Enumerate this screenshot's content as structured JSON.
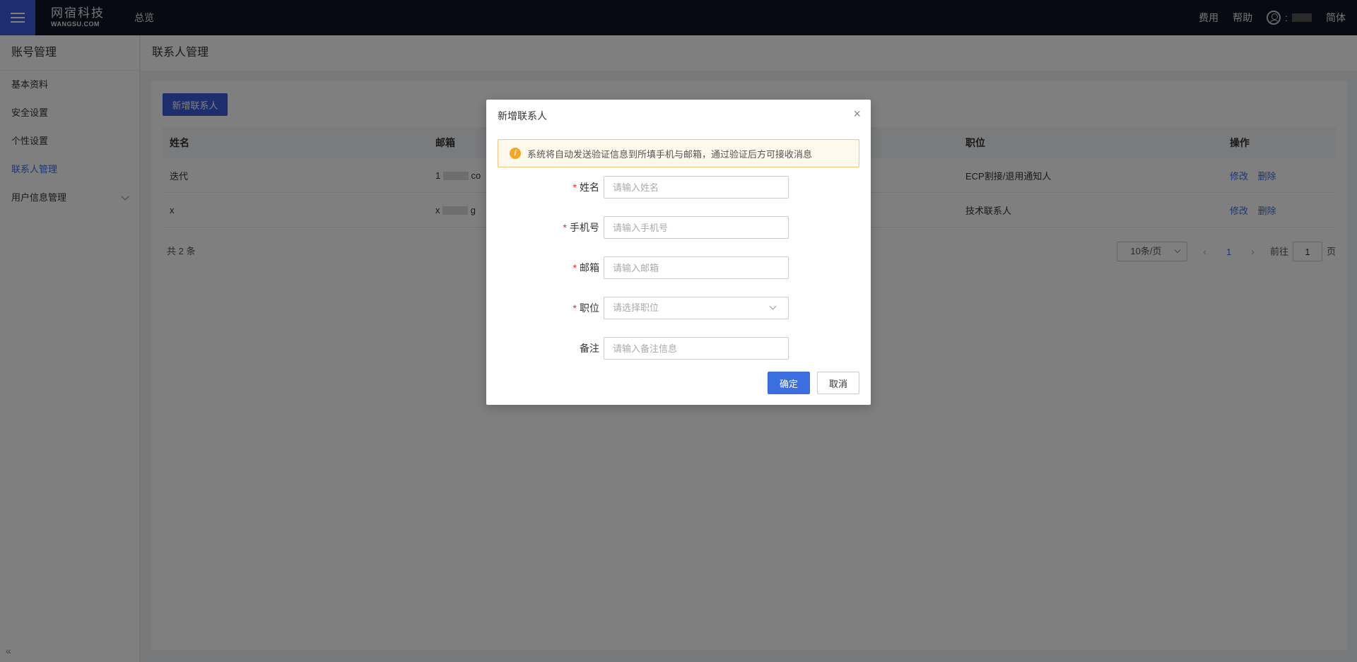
{
  "topbar": {
    "logo_cn": "网宿科技",
    "logo_en": "WANGSU.COM",
    "nav_overview": "总览",
    "cost": "费用",
    "help": "帮助",
    "user_prefix": ":",
    "language": "简体"
  },
  "sidebar": {
    "title": "账号管理",
    "items": [
      {
        "label": "基本资料"
      },
      {
        "label": "安全设置"
      },
      {
        "label": "个性设置"
      },
      {
        "label": "联系人管理"
      },
      {
        "label": "用户信息管理"
      }
    ],
    "collapse": "«"
  },
  "page": {
    "title": "联系人管理",
    "add_button": "新增联系人"
  },
  "table": {
    "headers": [
      "姓名",
      "邮箱",
      "",
      "职位",
      "操作"
    ],
    "rows": [
      {
        "name": "迭代",
        "email_prefix": "1",
        "email_suffix": "co",
        "position": "ECP割接/退用通知人",
        "edit": "修改",
        "delete": "删除"
      },
      {
        "name": "x",
        "email_prefix": "x",
        "email_suffix": "g",
        "position": "技术联系人",
        "edit": "修改",
        "delete": "删除"
      }
    ]
  },
  "pagination": {
    "total": "共 2 条",
    "page_size": "10条/页",
    "prev": "‹",
    "current": "1",
    "next": "›",
    "goto_label": "前往",
    "goto_value": "1",
    "page_suffix": "页"
  },
  "dialog": {
    "title": "新增联系人",
    "close": "×",
    "notice": "系统将自动发送验证信息到所填手机与邮箱，通过验证后方可接收消息",
    "fields": [
      {
        "label": "姓名",
        "required": "*",
        "placeholder": "请输入姓名"
      },
      {
        "label": "手机号",
        "required": "*",
        "placeholder": "请输入手机号"
      },
      {
        "label": "邮箱",
        "required": "*",
        "placeholder": "请输入邮箱"
      },
      {
        "label": "职位",
        "required": "*",
        "placeholder": "请选择职位"
      },
      {
        "label": "备注",
        "required": "",
        "placeholder": "请输入备注信息"
      }
    ],
    "confirm": "确定",
    "cancel": "取消"
  },
  "colors": {
    "primary": "#3b6fe0",
    "topbar": "#0e1524",
    "warning": "#f5a623"
  }
}
